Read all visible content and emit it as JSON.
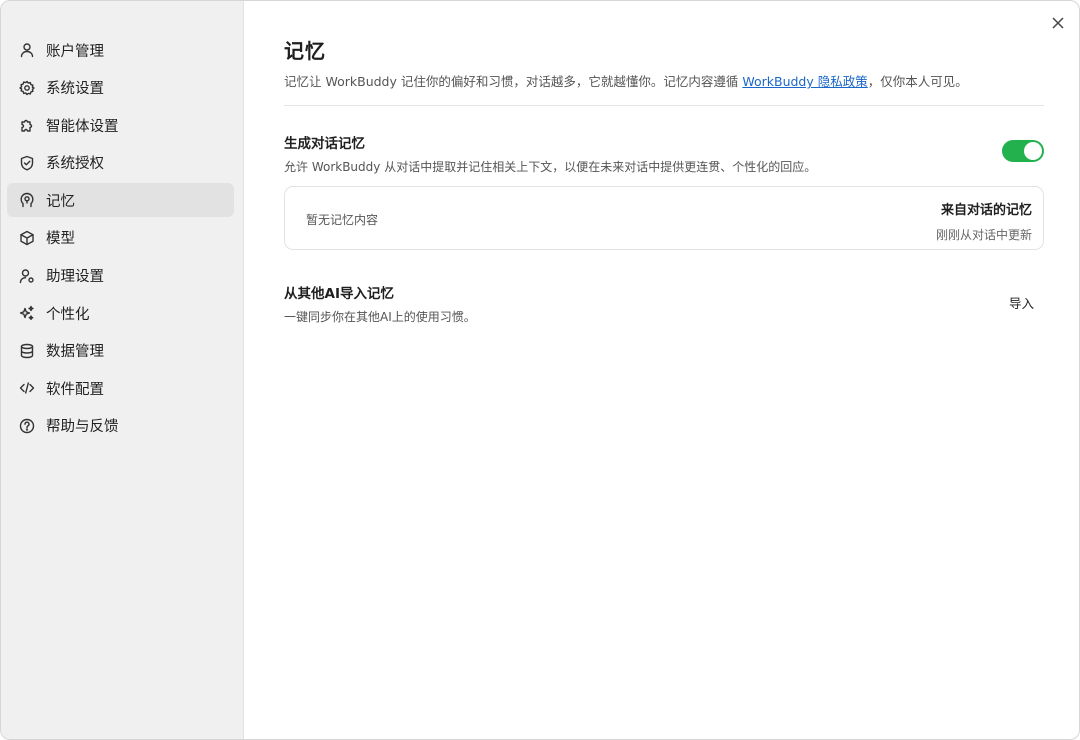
{
  "sidebar": {
    "items": [
      {
        "label": "账户管理",
        "icon": "user-icon",
        "active": false
      },
      {
        "label": "系统设置",
        "icon": "gear-icon",
        "active": false
      },
      {
        "label": "智能体设置",
        "icon": "puzzle-icon",
        "active": false
      },
      {
        "label": "系统授权",
        "icon": "shield-icon",
        "active": false
      },
      {
        "label": "记忆",
        "icon": "memory-head-icon",
        "active": true
      },
      {
        "label": "模型",
        "icon": "cube-icon",
        "active": false
      },
      {
        "label": "助理设置",
        "icon": "user-gear-icon",
        "active": false
      },
      {
        "label": "个性化",
        "icon": "sparkle-icon",
        "active": false
      },
      {
        "label": "数据管理",
        "icon": "database-icon",
        "active": false
      },
      {
        "label": "软件配置",
        "icon": "code-icon",
        "active": false
      },
      {
        "label": "帮助与反馈",
        "icon": "help-icon",
        "active": false
      }
    ]
  },
  "page": {
    "title": "记忆",
    "desc_before": "记忆让 WorkBuddy 记住你的偏好和习惯，对话越多，它就越懂你。记忆内容遵循 ",
    "desc_link": "WorkBuddy 隐私政策",
    "desc_after": "，仅你本人可见。"
  },
  "conversation_memory": {
    "title": "生成对话记忆",
    "desc": "允许 WorkBuddy 从对话中提取并记住相关上下文，以便在未来对话中提供更连贯、个性化的回应。",
    "enabled": true,
    "empty_text": "暂无记忆内容",
    "source_title": "来自对话的记忆",
    "source_status": "刚刚从对话中更新"
  },
  "import_memory": {
    "title": "从其他AI导入记忆",
    "desc": "一键同步你在其他AI上的使用习惯。",
    "button_label": "导入"
  },
  "colors": {
    "toggle_on": "#22b14c",
    "link": "#1a66c9",
    "sidebar_bg": "#f0f0f0",
    "active_item_bg": "#e2e2e2"
  }
}
